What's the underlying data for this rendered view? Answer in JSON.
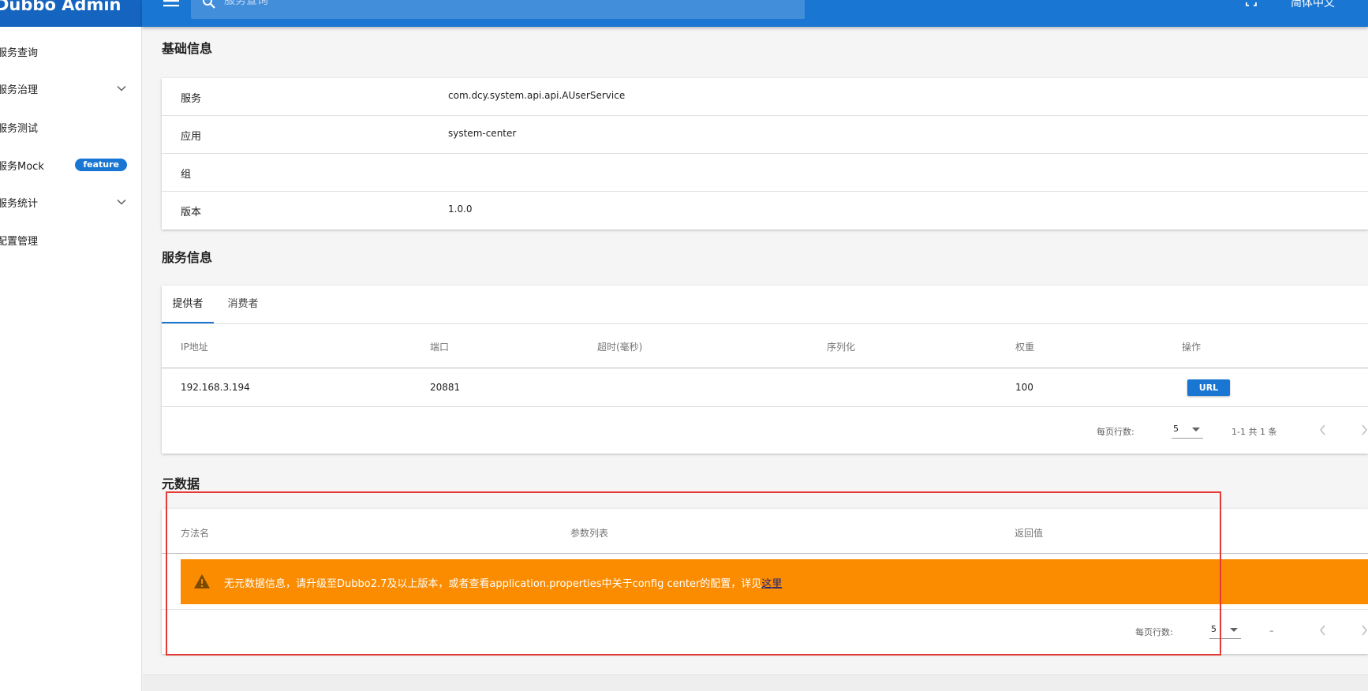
{
  "app": {
    "title": "Dubbo Admin"
  },
  "sidebar": {
    "items": [
      {
        "label": "服务查询",
        "has_chevron": false
      },
      {
        "label": "服务治理",
        "has_chevron": true
      },
      {
        "label": "服务测试",
        "has_chevron": false
      },
      {
        "label": "服务Mock",
        "has_chevron": false,
        "badge": "feature"
      },
      {
        "label": "服务统计",
        "has_chevron": true
      },
      {
        "label": "配置管理",
        "has_chevron": false
      }
    ]
  },
  "topbar": {
    "search_placeholder": "服务查询",
    "language": "简体中文",
    "icons": [
      "menu-icon",
      "search-icon",
      "fullscreen-icon"
    ]
  },
  "basic_info": {
    "title": "基础信息",
    "rows": [
      {
        "key": "服务",
        "value": "com.dcy.system.api.api.AUserService"
      },
      {
        "key": "应用",
        "value": "system-center"
      },
      {
        "key": "组",
        "value": ""
      },
      {
        "key": "版本",
        "value": "1.0.0"
      }
    ]
  },
  "service_info": {
    "title": "服务信息",
    "tabs": [
      "提供者",
      "消费者"
    ],
    "active_tab": 0,
    "columns": [
      "IP地址",
      "端口",
      "超时(毫秒)",
      "序列化",
      "权重",
      "操作"
    ],
    "rows": [
      {
        "ip": "192.168.3.194",
        "port": "20881",
        "timeout": "",
        "serialization": "",
        "weight": "100",
        "action": "URL"
      }
    ],
    "pagination": {
      "rows_per_page_label": "每页行数:",
      "rows_per_page": "5",
      "range_text": "1-1 共 1 条"
    }
  },
  "metadata": {
    "title": "元数据",
    "columns": [
      "方法名",
      "参数列表",
      "返回值"
    ],
    "warning_text": "无元数据信息，请升级至Dubbo2.7及以上版本，或者查看application.properties中关于config center的配置，详见",
    "warning_link": "这里",
    "pagination": {
      "rows_per_page_label": "每页行数:",
      "rows_per_page": "5",
      "range_text": "–"
    }
  },
  "colors": {
    "primary": "#1976d2",
    "brand_dark": "#1565c0",
    "warning": "#fb8c00",
    "highlight_border": "#e53935"
  }
}
